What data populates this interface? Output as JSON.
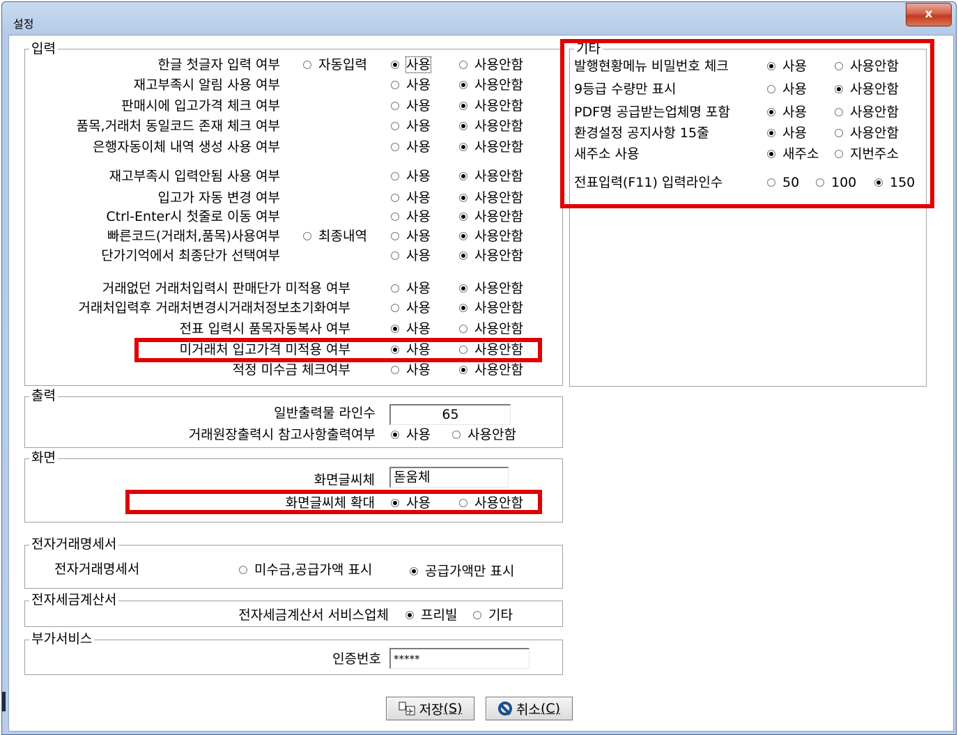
{
  "window": {
    "title": "설정",
    "close_label": "x"
  },
  "input_group": {
    "title": "입력",
    "rows": [
      {
        "label": "한글 첫글자 입력 여부",
        "extra_option": "자동입력",
        "use": "사용",
        "no_use": "사용안함",
        "selected": "use"
      },
      {
        "label": "재고부족시 알림 사용 여부",
        "use": "사용",
        "no_use": "사용안함",
        "selected": "no_use"
      },
      {
        "label": "판매시에 입고가격 체크 여부",
        "use": "사용",
        "no_use": "사용안함",
        "selected": "no_use"
      },
      {
        "label": "품목,거래처 동일코드 존재 체크 여부",
        "use": "사용",
        "no_use": "사용안함",
        "selected": "no_use"
      },
      {
        "label": "은행자동이체 내역 생성 사용 여부",
        "use": "사용",
        "no_use": "사용안함",
        "selected": "no_use"
      },
      {
        "label": "재고부족시 입력안됨 사용 여부",
        "use": "사용",
        "no_use": "사용안함",
        "selected": "no_use"
      },
      {
        "label": "입고가 자동 변경 여부",
        "use": "사용",
        "no_use": "사용안함",
        "selected": "no_use"
      },
      {
        "label": "Ctrl-Enter시 첫줄로 이동 여부",
        "use": "사용",
        "no_use": "사용안함",
        "selected": "no_use"
      },
      {
        "label": "빠른코드(거래처,품목)사용여부",
        "extra_option": "최종내역",
        "use": "사용",
        "no_use": "사용안함",
        "selected": "no_use"
      },
      {
        "label": "단가기억에서 최종단가 선택여부",
        "use": "사용",
        "no_use": "사용안함",
        "selected": "no_use"
      },
      {
        "label": "거래없던 거래처입력시 판매단가 미적용 여부",
        "use": "사용",
        "no_use": "사용안함",
        "selected": "no_use"
      },
      {
        "label": "거래처입력후 거래처변경시거래처정보초기화여부",
        "use": "사용",
        "no_use": "사용안함",
        "selected": "no_use"
      },
      {
        "label": "전표 입력시 품목자동복사 여부",
        "use": "사용",
        "no_use": "사용안함",
        "selected": "use"
      },
      {
        "label": "미거래처 입고가격 미적용 여부",
        "use": "사용",
        "no_use": "사용안함",
        "selected": "use"
      },
      {
        "label": "적정 미수금 체크여부",
        "use": "사용",
        "no_use": "사용안함",
        "selected": "no_use"
      }
    ]
  },
  "etc_group": {
    "title": "기타",
    "rows": [
      {
        "label": "발행현황메뉴 비밀번호 체크",
        "options": [
          "사용",
          "사용안함"
        ],
        "selected": 0
      },
      {
        "label": "9등급 수량만 표시",
        "options": [
          "사용",
          "사용안함"
        ],
        "selected": 1
      },
      {
        "label": "PDF명 공급받는업체명 포함",
        "options": [
          "사용",
          "사용안함"
        ],
        "selected": 0
      },
      {
        "label": "환경설정 공지사항 15줄",
        "options": [
          "사용",
          "사용안함"
        ],
        "selected": 0
      },
      {
        "label": "새주소 사용",
        "options": [
          "새주소",
          "지번주소"
        ],
        "selected": 0
      },
      {
        "label": "전표입력(F11) 입력라인수",
        "options": [
          "50",
          "100",
          "150"
        ],
        "selected": 2
      }
    ]
  },
  "output_group": {
    "title": "출력",
    "line_count_label": "일반출력물 라인수",
    "line_count_value": "65",
    "ref_label": "거래원장출력시 참고사항출력여부",
    "ref_use": "사용",
    "ref_no_use": "사용안함",
    "ref_selected": "use"
  },
  "screen_group": {
    "title": "화면",
    "font_label": "화면글씨체",
    "font_value": "돋움체",
    "zoom_label": "화면글씨체 확대",
    "zoom_use": "사용",
    "zoom_no_use": "사용안함",
    "zoom_selected": "use"
  },
  "etrade_group": {
    "title": "전자거래명세서",
    "label": "전자거래명세서",
    "option_a": "미수금,공급가액 표시",
    "option_b": "공급가액만 표시",
    "selected": "option_b"
  },
  "etax_group": {
    "title": "전자세금계산서",
    "label": "전자세금계산서 서비스업체",
    "option_a": "프리빌",
    "option_b": "기타",
    "selected": "option_a"
  },
  "addon_group": {
    "title": "부가서비스",
    "auth_label": "인증번호",
    "auth_value": "*****"
  },
  "buttons": {
    "save_label": "저장",
    "save_key": "(S)",
    "cancel_label": "취소",
    "cancel_key": "(C)"
  }
}
